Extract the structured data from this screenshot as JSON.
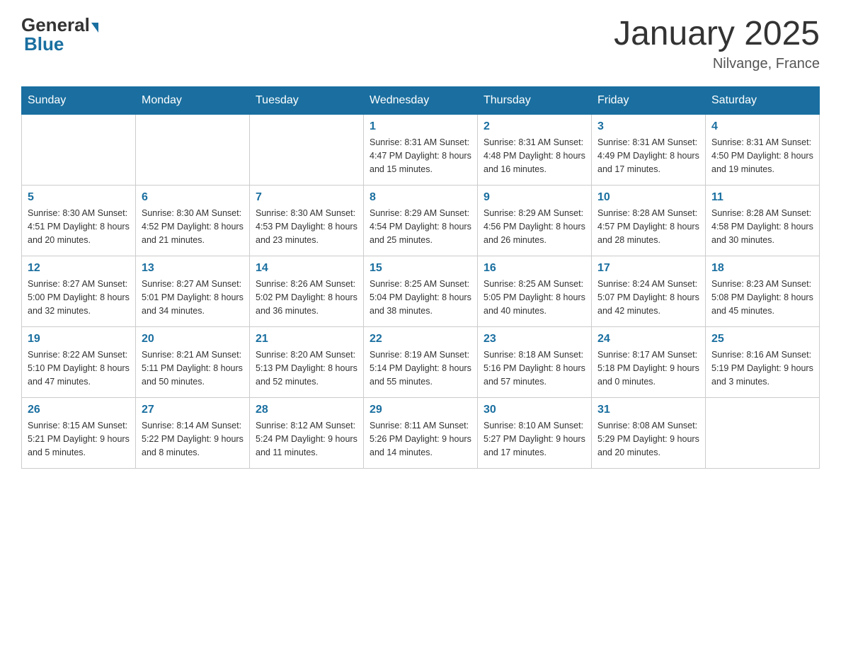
{
  "header": {
    "logo_general": "General",
    "logo_blue": "Blue",
    "title": "January 2025",
    "subtitle": "Nilvange, France"
  },
  "days_of_week": [
    "Sunday",
    "Monday",
    "Tuesday",
    "Wednesday",
    "Thursday",
    "Friday",
    "Saturday"
  ],
  "weeks": [
    [
      {
        "day": "",
        "info": ""
      },
      {
        "day": "",
        "info": ""
      },
      {
        "day": "",
        "info": ""
      },
      {
        "day": "1",
        "info": "Sunrise: 8:31 AM\nSunset: 4:47 PM\nDaylight: 8 hours\nand 15 minutes."
      },
      {
        "day": "2",
        "info": "Sunrise: 8:31 AM\nSunset: 4:48 PM\nDaylight: 8 hours\nand 16 minutes."
      },
      {
        "day": "3",
        "info": "Sunrise: 8:31 AM\nSunset: 4:49 PM\nDaylight: 8 hours\nand 17 minutes."
      },
      {
        "day": "4",
        "info": "Sunrise: 8:31 AM\nSunset: 4:50 PM\nDaylight: 8 hours\nand 19 minutes."
      }
    ],
    [
      {
        "day": "5",
        "info": "Sunrise: 8:30 AM\nSunset: 4:51 PM\nDaylight: 8 hours\nand 20 minutes."
      },
      {
        "day": "6",
        "info": "Sunrise: 8:30 AM\nSunset: 4:52 PM\nDaylight: 8 hours\nand 21 minutes."
      },
      {
        "day": "7",
        "info": "Sunrise: 8:30 AM\nSunset: 4:53 PM\nDaylight: 8 hours\nand 23 minutes."
      },
      {
        "day": "8",
        "info": "Sunrise: 8:29 AM\nSunset: 4:54 PM\nDaylight: 8 hours\nand 25 minutes."
      },
      {
        "day": "9",
        "info": "Sunrise: 8:29 AM\nSunset: 4:56 PM\nDaylight: 8 hours\nand 26 minutes."
      },
      {
        "day": "10",
        "info": "Sunrise: 8:28 AM\nSunset: 4:57 PM\nDaylight: 8 hours\nand 28 minutes."
      },
      {
        "day": "11",
        "info": "Sunrise: 8:28 AM\nSunset: 4:58 PM\nDaylight: 8 hours\nand 30 minutes."
      }
    ],
    [
      {
        "day": "12",
        "info": "Sunrise: 8:27 AM\nSunset: 5:00 PM\nDaylight: 8 hours\nand 32 minutes."
      },
      {
        "day": "13",
        "info": "Sunrise: 8:27 AM\nSunset: 5:01 PM\nDaylight: 8 hours\nand 34 minutes."
      },
      {
        "day": "14",
        "info": "Sunrise: 8:26 AM\nSunset: 5:02 PM\nDaylight: 8 hours\nand 36 minutes."
      },
      {
        "day": "15",
        "info": "Sunrise: 8:25 AM\nSunset: 5:04 PM\nDaylight: 8 hours\nand 38 minutes."
      },
      {
        "day": "16",
        "info": "Sunrise: 8:25 AM\nSunset: 5:05 PM\nDaylight: 8 hours\nand 40 minutes."
      },
      {
        "day": "17",
        "info": "Sunrise: 8:24 AM\nSunset: 5:07 PM\nDaylight: 8 hours\nand 42 minutes."
      },
      {
        "day": "18",
        "info": "Sunrise: 8:23 AM\nSunset: 5:08 PM\nDaylight: 8 hours\nand 45 minutes."
      }
    ],
    [
      {
        "day": "19",
        "info": "Sunrise: 8:22 AM\nSunset: 5:10 PM\nDaylight: 8 hours\nand 47 minutes."
      },
      {
        "day": "20",
        "info": "Sunrise: 8:21 AM\nSunset: 5:11 PM\nDaylight: 8 hours\nand 50 minutes."
      },
      {
        "day": "21",
        "info": "Sunrise: 8:20 AM\nSunset: 5:13 PM\nDaylight: 8 hours\nand 52 minutes."
      },
      {
        "day": "22",
        "info": "Sunrise: 8:19 AM\nSunset: 5:14 PM\nDaylight: 8 hours\nand 55 minutes."
      },
      {
        "day": "23",
        "info": "Sunrise: 8:18 AM\nSunset: 5:16 PM\nDaylight: 8 hours\nand 57 minutes."
      },
      {
        "day": "24",
        "info": "Sunrise: 8:17 AM\nSunset: 5:18 PM\nDaylight: 9 hours\nand 0 minutes."
      },
      {
        "day": "25",
        "info": "Sunrise: 8:16 AM\nSunset: 5:19 PM\nDaylight: 9 hours\nand 3 minutes."
      }
    ],
    [
      {
        "day": "26",
        "info": "Sunrise: 8:15 AM\nSunset: 5:21 PM\nDaylight: 9 hours\nand 5 minutes."
      },
      {
        "day": "27",
        "info": "Sunrise: 8:14 AM\nSunset: 5:22 PM\nDaylight: 9 hours\nand 8 minutes."
      },
      {
        "day": "28",
        "info": "Sunrise: 8:12 AM\nSunset: 5:24 PM\nDaylight: 9 hours\nand 11 minutes."
      },
      {
        "day": "29",
        "info": "Sunrise: 8:11 AM\nSunset: 5:26 PM\nDaylight: 9 hours\nand 14 minutes."
      },
      {
        "day": "30",
        "info": "Sunrise: 8:10 AM\nSunset: 5:27 PM\nDaylight: 9 hours\nand 17 minutes."
      },
      {
        "day": "31",
        "info": "Sunrise: 8:08 AM\nSunset: 5:29 PM\nDaylight: 9 hours\nand 20 minutes."
      },
      {
        "day": "",
        "info": ""
      }
    ]
  ]
}
